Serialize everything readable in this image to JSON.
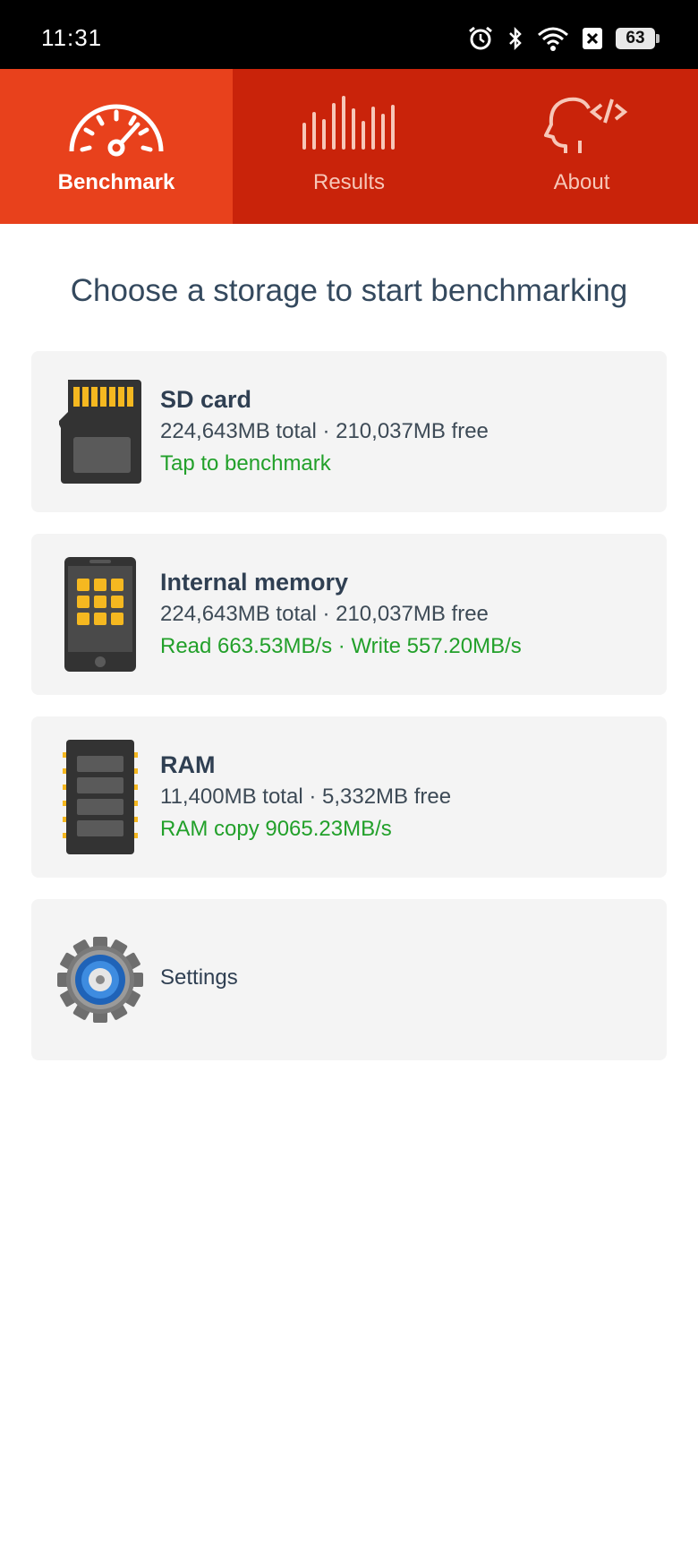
{
  "status_bar": {
    "time": "11:31",
    "battery": "63"
  },
  "tabs": [
    {
      "label": "Benchmark",
      "icon": "speedometer-icon",
      "active": true
    },
    {
      "label": "Results",
      "icon": "bars-icon",
      "active": false
    },
    {
      "label": "About",
      "icon": "head-code-icon",
      "active": false
    }
  ],
  "heading": "Choose a storage to start benchmarking",
  "storages": [
    {
      "title": "SD card",
      "details": "224,643MB total · 210,037MB free",
      "status": "Tap to benchmark",
      "icon": "sd-card-icon"
    },
    {
      "title": "Internal memory",
      "details": "224,643MB total · 210,037MB free",
      "status": "Read 663.53MB/s · Write 557.20MB/s",
      "icon": "phone-icon"
    },
    {
      "title": "RAM",
      "details": "11,400MB total · 5,332MB free",
      "status": "RAM copy 9065.23MB/s",
      "icon": "ram-chip-icon"
    }
  ],
  "settings": {
    "label": "Settings",
    "icon": "gear-icon"
  },
  "colors": {
    "tab_active": "#e8411c",
    "tab_bar": "#c9230a",
    "status_green": "#22a02a",
    "text_dark": "#34495e"
  }
}
